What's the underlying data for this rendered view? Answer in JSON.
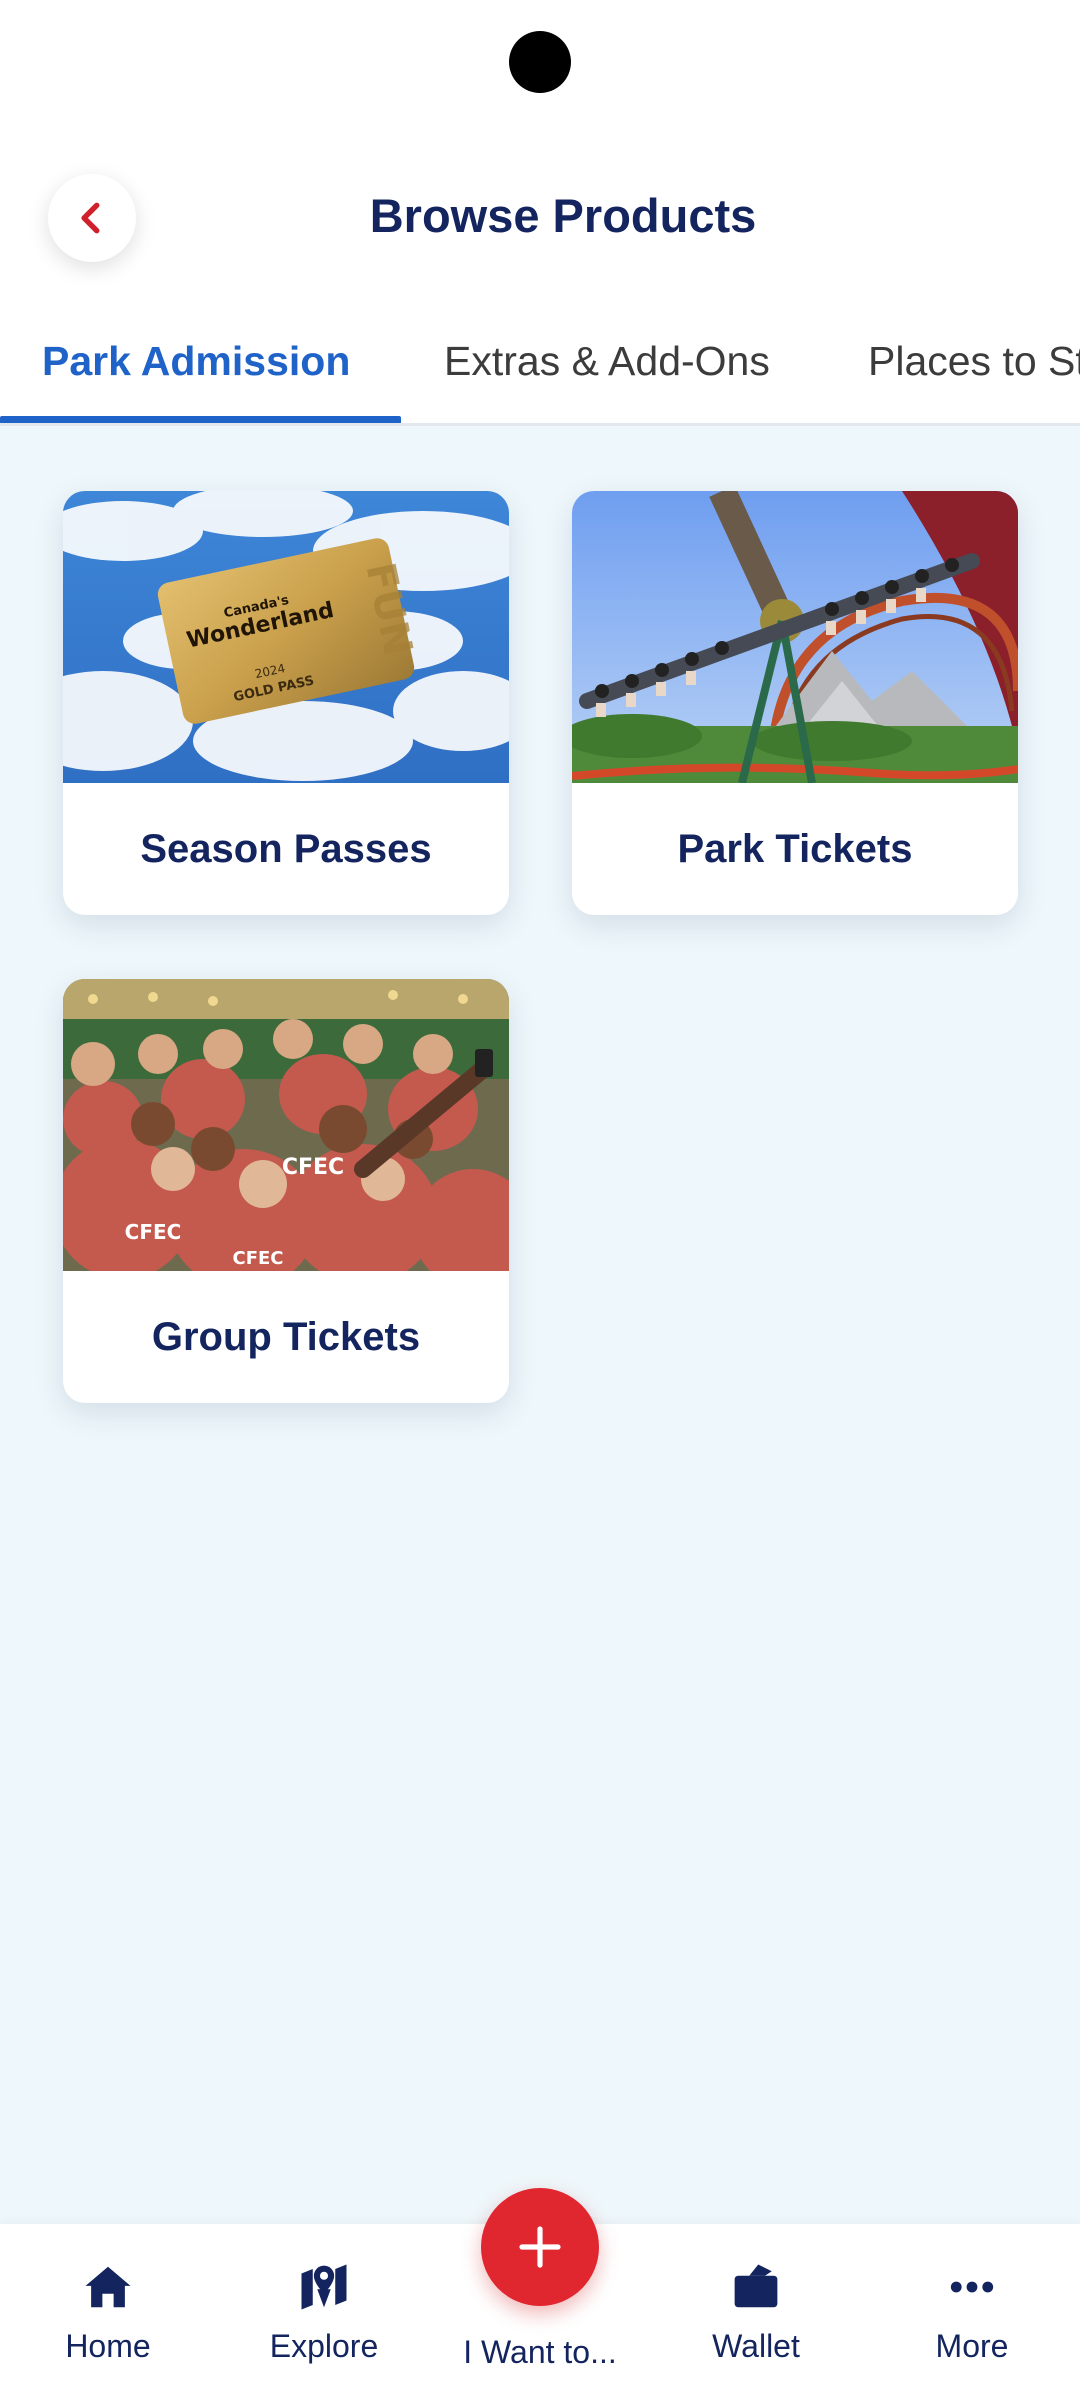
{
  "header": {
    "title": "Browse Products",
    "back_icon": "chevron-left-icon"
  },
  "tabs": [
    {
      "label": "Park Admission",
      "active": true
    },
    {
      "label": "Extras & Add-Ons",
      "active": false
    },
    {
      "label": "Places to St",
      "active": false
    }
  ],
  "products": [
    {
      "label": "Season Passes",
      "image": "gold-pass-card-sky-image",
      "pass_brand": "Canada's",
      "pass_name": "Wonderland",
      "pass_year": "2024",
      "pass_type": "GOLD PASS",
      "pass_side": "FUN"
    },
    {
      "label": "Park Tickets",
      "image": "roller-coaster-riders-image"
    },
    {
      "label": "Group Tickets",
      "image": "group-selfie-red-shirts-image",
      "shirt_text": "CFEC"
    }
  ],
  "bottom_nav": [
    {
      "label": "Home",
      "icon": "home-icon"
    },
    {
      "label": "Explore",
      "icon": "map-pin-icon"
    },
    {
      "label": "I Want to...",
      "icon": "plus-icon"
    },
    {
      "label": "Wallet",
      "icon": "wallet-icon"
    },
    {
      "label": "More",
      "icon": "ellipsis-icon"
    }
  ],
  "colors": {
    "brand_navy": "#13245e",
    "active_tab": "#1f63c8",
    "accent_red": "#e0262f",
    "back_chevron": "#d0202b",
    "content_bg": "#eef7fb"
  }
}
